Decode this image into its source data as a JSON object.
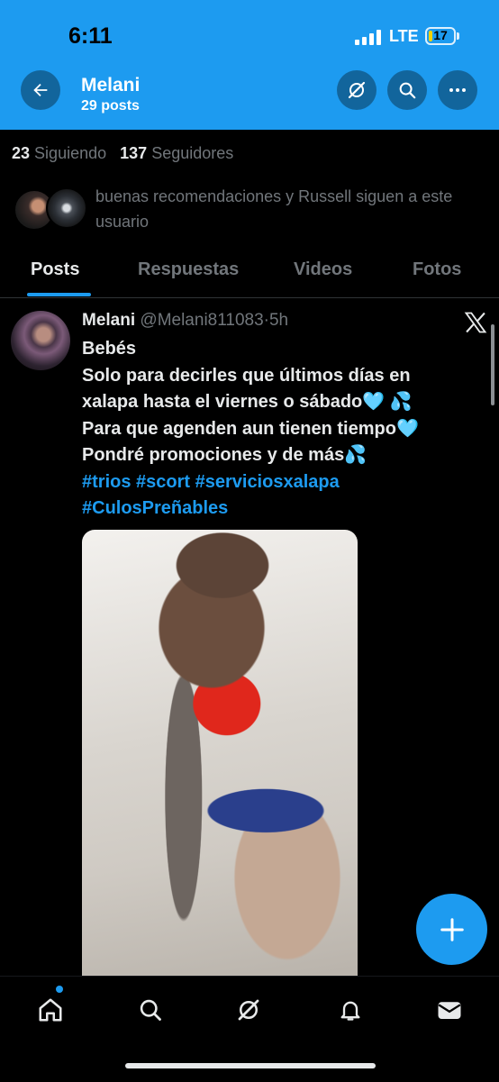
{
  "status_bar": {
    "time": "6:11",
    "network": "LTE",
    "battery": "17",
    "battery_level": 0.17
  },
  "header": {
    "title": "Melani",
    "subtitle": "29 posts"
  },
  "profile": {
    "following_count": "23",
    "following_label": "Siguiendo",
    "followers_count": "137",
    "followers_label": "Seguidores",
    "followed_by_text": "buenas recomendaciones y Russell siguen a este usuario"
  },
  "tabs": [
    {
      "label": "Posts",
      "active": true
    },
    {
      "label": "Respuestas",
      "active": false
    },
    {
      "label": "Videos",
      "active": false
    },
    {
      "label": "Fotos",
      "active": false
    }
  ],
  "post": {
    "name": "Melani",
    "handle": "@Melani811083",
    "separator": "·",
    "time": "5h",
    "lines": [
      "Bebés",
      "Solo para decirles que últimos días en",
      "xalapa hasta el viernes o sábado🩵 💦",
      "Para que agenden aun tienen tiempo🩵",
      "Pondré promociones y de más💦"
    ],
    "hashtags_line1": "#trios #scort #serviciosxalapa",
    "hashtags_line2": "#CulosPreñables"
  },
  "icons": {
    "back": "arrow-left-icon",
    "grok": "grok-icon",
    "search": "search-icon",
    "more": "more-icon",
    "x_logo": "x-logo-icon",
    "compose": "plus-icon",
    "nav": [
      "home-icon",
      "search-icon",
      "grok-icon",
      "bell-icon",
      "mail-icon"
    ]
  },
  "colors": {
    "accent": "#1d9bf0",
    "background": "#000000",
    "text": "#e7e9ea",
    "muted": "#71767b"
  }
}
